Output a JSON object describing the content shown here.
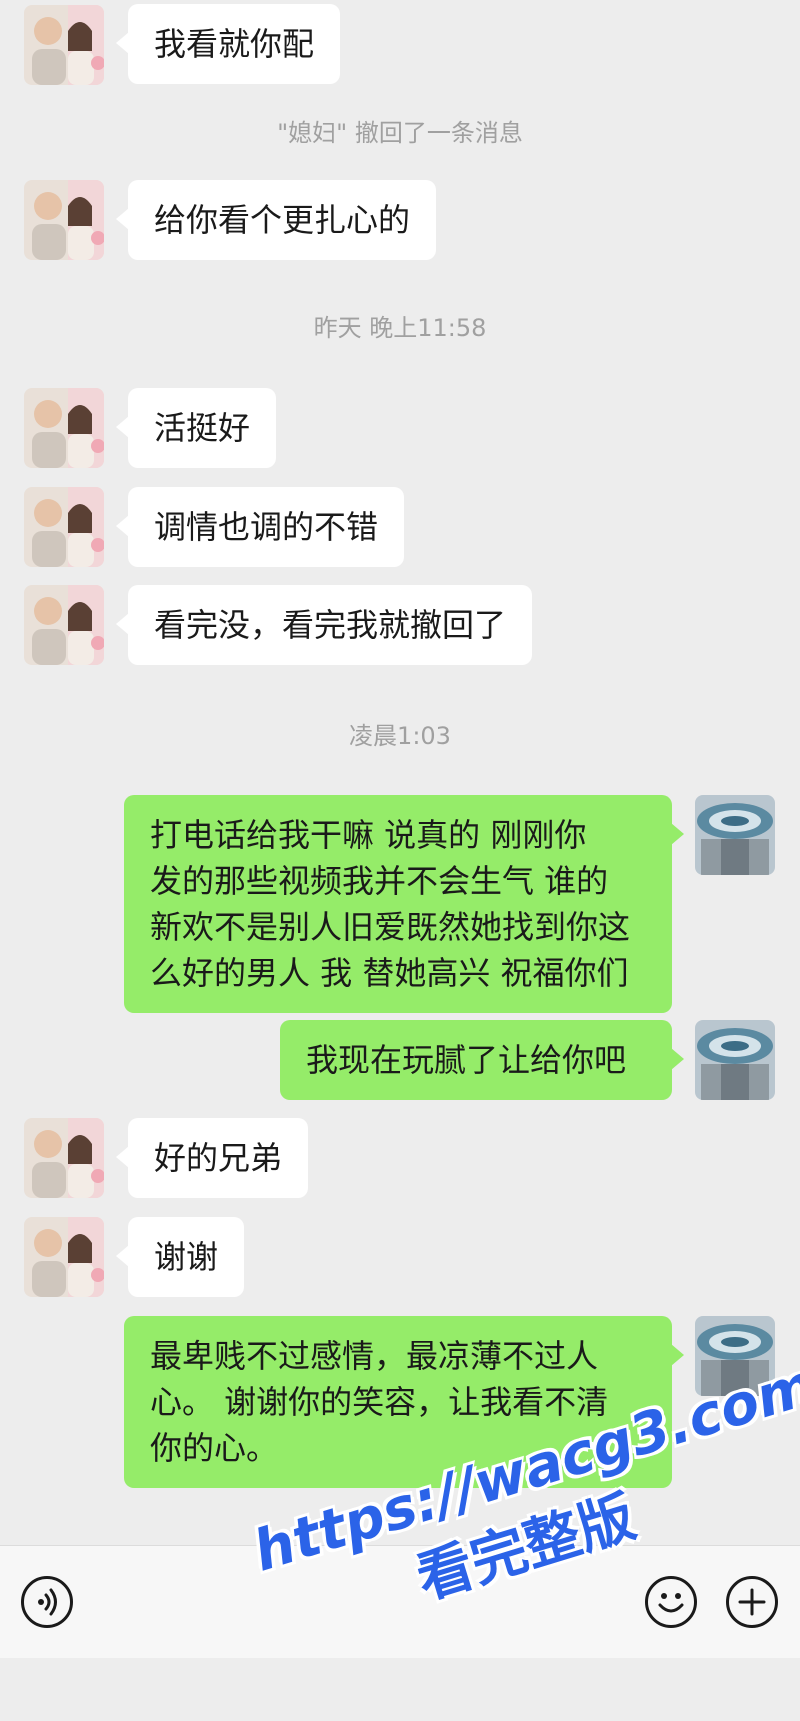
{
  "messages": [
    {
      "type": "in",
      "text": "我看就你配"
    },
    {
      "type": "system",
      "text": "\"媳妇\" 撤回了一条消息"
    },
    {
      "type": "in",
      "text": "给你看个更扎心的"
    },
    {
      "type": "system",
      "text": "昨天 晚上11:58"
    },
    {
      "type": "in",
      "text": "活挺好"
    },
    {
      "type": "in",
      "text": "调情也调的不错"
    },
    {
      "type": "in",
      "text": "看完没，看完我就撤回了"
    },
    {
      "type": "system",
      "text": "凌晨1:03"
    },
    {
      "type": "out",
      "lines": [
        "打电话给我干嘛  说真的  刚刚你",
        "发的那些视频我并不会生气  谁的",
        "新欢不是别人旧爱既然她找到你这",
        "么好的男人 我 替她高兴  祝福你们"
      ]
    },
    {
      "type": "out",
      "lines": [
        "我现在玩腻了让给你吧"
      ]
    },
    {
      "type": "in",
      "text": "好的兄弟"
    },
    {
      "type": "in",
      "text": "谢谢"
    },
    {
      "type": "out",
      "lines": [
        "最卑贱不过感情，最凉薄不过人",
        "心。 谢谢你的笑容，让我看不清",
        "你的心。"
      ]
    }
  ],
  "input_bar": {
    "voice_icon": "voice-icon",
    "emoji_icon": "emoji-icon",
    "plus_icon": "plus-icon"
  },
  "watermark": {
    "url": "https://wacg3.com",
    "caption": "看完整版"
  },
  "colors": {
    "background": "#ededed",
    "incoming_bubble": "#ffffff",
    "outgoing_bubble": "#95ec69",
    "system_text": "#a0a0a0",
    "watermark": "#2b63e8"
  }
}
